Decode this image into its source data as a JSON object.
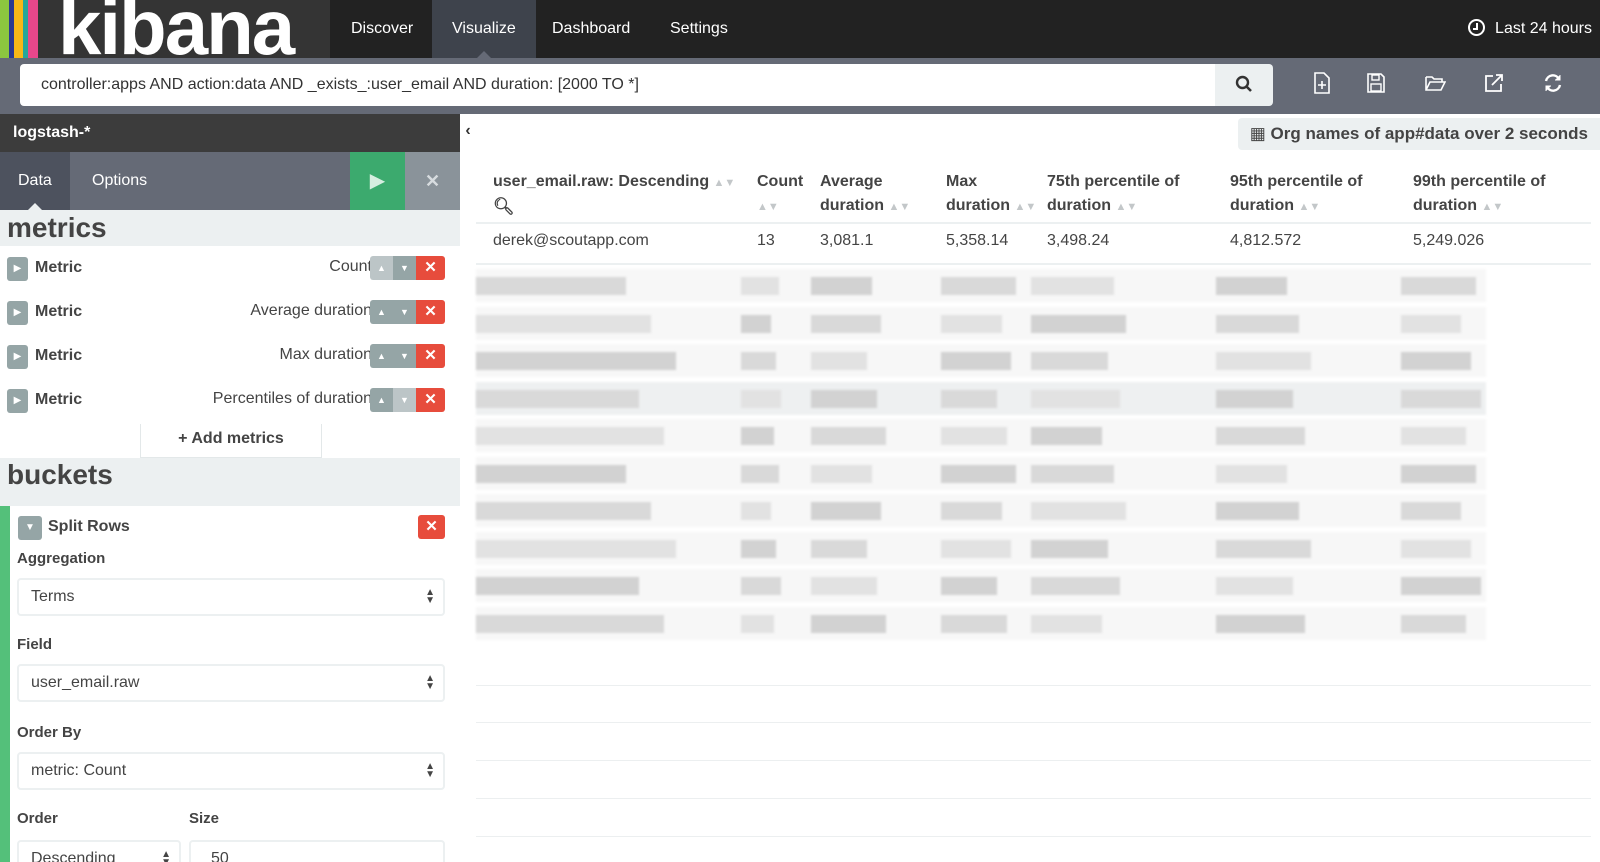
{
  "nav": {
    "logo": "kibana",
    "items": [
      "Discover",
      "Visualize",
      "Dashboard",
      "Settings"
    ],
    "active": "Visualize",
    "time": "Last 24 hours"
  },
  "query": {
    "value": "controller:apps AND action:data AND _exists_:user_email AND duration: [2000 TO *]"
  },
  "toolbar": {
    "icons": [
      "new-icon",
      "save-icon",
      "open-icon",
      "share-icon",
      "refresh-icon"
    ]
  },
  "sidebar": {
    "index": "logstash-*",
    "tabs": [
      "Data",
      "Options"
    ],
    "metrics_heading": "metrics",
    "metrics": [
      {
        "label": "Metric",
        "value": "Count"
      },
      {
        "label": "Metric",
        "value": "Average duration"
      },
      {
        "label": "Metric",
        "value": "Max duration"
      },
      {
        "label": "Metric",
        "value": "Percentiles of duration"
      }
    ],
    "add_metrics": "Add metrics",
    "buckets_heading": "buckets",
    "bucket": {
      "title": "Split Rows",
      "aggregation_label": "Aggregation",
      "aggregation": "Terms",
      "field_label": "Field",
      "field": "user_email.raw",
      "orderby_label": "Order By",
      "orderby": "metric: Count",
      "order_label": "Order",
      "order": "Descending",
      "size_label": "Size",
      "size": "50"
    }
  },
  "main": {
    "title": "Org names of app#data over 2 seconds",
    "columns": [
      "user_email.raw: Descending",
      "Count",
      "Average duration",
      "Max duration",
      "75th percentile of duration",
      "95th percentile of duration",
      "99th percentile of duration"
    ],
    "rows": [
      [
        "derek@scoutapp.com",
        "13",
        "3,081.1",
        "5,358.14",
        "3,498.24",
        "4,812.572",
        "5,249.026"
      ]
    ]
  },
  "colors": {
    "accent": "#3caa6e",
    "danger": "#e74c3c",
    "nav": "#222222",
    "bar": "#656a76"
  }
}
